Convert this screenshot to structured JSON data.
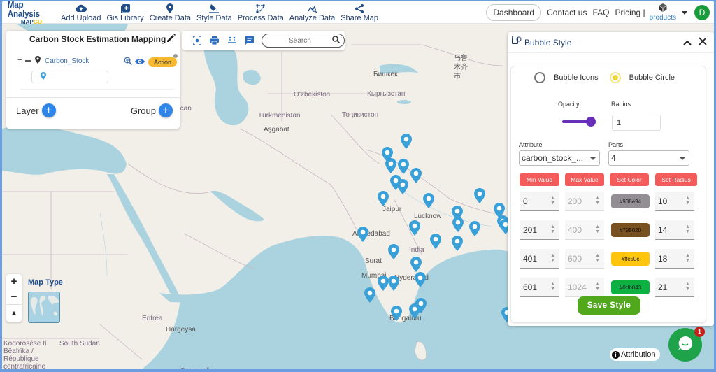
{
  "app": {
    "brand_title": "Map Analysis",
    "brand_sub_a": "MAP",
    "brand_sub_b": "GO"
  },
  "nav": [
    {
      "label": "Add Upload",
      "icon": "cloud-upload-icon"
    },
    {
      "label": "Gis Library",
      "icon": "library-plus-icon"
    },
    {
      "label": "Create Data",
      "icon": "location-pin-icon"
    },
    {
      "label": "Style Data",
      "icon": "paint-bucket-icon"
    },
    {
      "label": "Process Data",
      "icon": "process-icon"
    },
    {
      "label": "Analyze Data",
      "icon": "analyze-icon"
    },
    {
      "label": "Share Map",
      "icon": "share-icon"
    }
  ],
  "top_right": {
    "dashboard": "Dashboard",
    "contact": "Contact us",
    "faq": "FAQ",
    "pricing": "Pricing |",
    "products": "products",
    "avatar_initial": "D"
  },
  "layer_panel": {
    "title": "Carbon Stock Estimation Mapping",
    "layer_name": "Carbon_Stock",
    "action_label": "Action",
    "layer_label": "Layer",
    "group_label": "Group"
  },
  "map_toolbar": {
    "search_placeholder": "Search"
  },
  "bubble_style": {
    "title": "Bubble Style",
    "option_icons": "Bubble Icons",
    "option_circle": "Bubble Circle",
    "selected_option": "Bubble Circle",
    "opacity_label": "Opacity",
    "opacity_value": 1.0,
    "radius_label": "Radius",
    "radius_value": "1",
    "attribute_label": "Attribute",
    "attribute_value": "carbon_stock_...",
    "parts_label": "Parts",
    "parts_value": "4",
    "col_min": "Min Value",
    "col_max": "Max Value",
    "col_color": "Set Color",
    "col_radius": "Set Radius",
    "rows": [
      {
        "min": "0",
        "max": "200",
        "color": "#938e94",
        "radius": "10"
      },
      {
        "min": "201",
        "max": "400",
        "color": "#795020",
        "radius": "14"
      },
      {
        "min": "401",
        "max": "600",
        "color": "#ffc50c",
        "radius": "18"
      },
      {
        "min": "601",
        "max": "1024",
        "color": "#0db043",
        "radius": "21"
      }
    ],
    "save_label": "Save Style"
  },
  "map_controls": {
    "zoom_in": "+",
    "zoom_out": "−",
    "north": "▲",
    "map_type_label": "Map Type"
  },
  "attribution": "Attribution",
  "chat_badge": "1",
  "map_labels": [
    {
      "text": "Azarbaycan",
      "type": "country"
    },
    {
      "text": "Türkmenistan",
      "type": "country"
    },
    {
      "text": "Aşgabat",
      "type": "city"
    },
    {
      "text": "Oʻzbekiston",
      "type": "country"
    },
    {
      "text": "Бишкек",
      "type": "city"
    },
    {
      "text": "Кыргызстан",
      "type": "country"
    },
    {
      "text": "Тоҷикистон",
      "type": "country"
    },
    {
      "text": "乌鲁木齐市",
      "type": "city"
    },
    {
      "text": "Ahmedabad",
      "type": "city"
    },
    {
      "text": "Lucknow",
      "type": "city"
    },
    {
      "text": "India",
      "type": "country"
    },
    {
      "text": "Surat",
      "type": "city"
    },
    {
      "text": "Mumbai",
      "type": "city"
    },
    {
      "text": "Hyderabad",
      "type": "city"
    },
    {
      "text": "Bengaluru",
      "type": "city"
    },
    {
      "text": "Jaipur",
      "type": "city"
    },
    {
      "text": "Hargeysa",
      "type": "city"
    },
    {
      "text": "South Sudan",
      "type": "country"
    },
    {
      "text": "Eritrea",
      "type": "country"
    },
    {
      "text": "Soomaaliya",
      "type": "country"
    },
    {
      "text": "Kodörösêse tî Bêafrîka / République centrafricaine",
      "type": "country"
    }
  ],
  "colors": {
    "accent_blue": "#2f86e8",
    "pin_blue": "#3aa0d8",
    "header_red": "#f45b5b",
    "save_green": "#52a81c",
    "action_yellow": "#f7b731"
  }
}
